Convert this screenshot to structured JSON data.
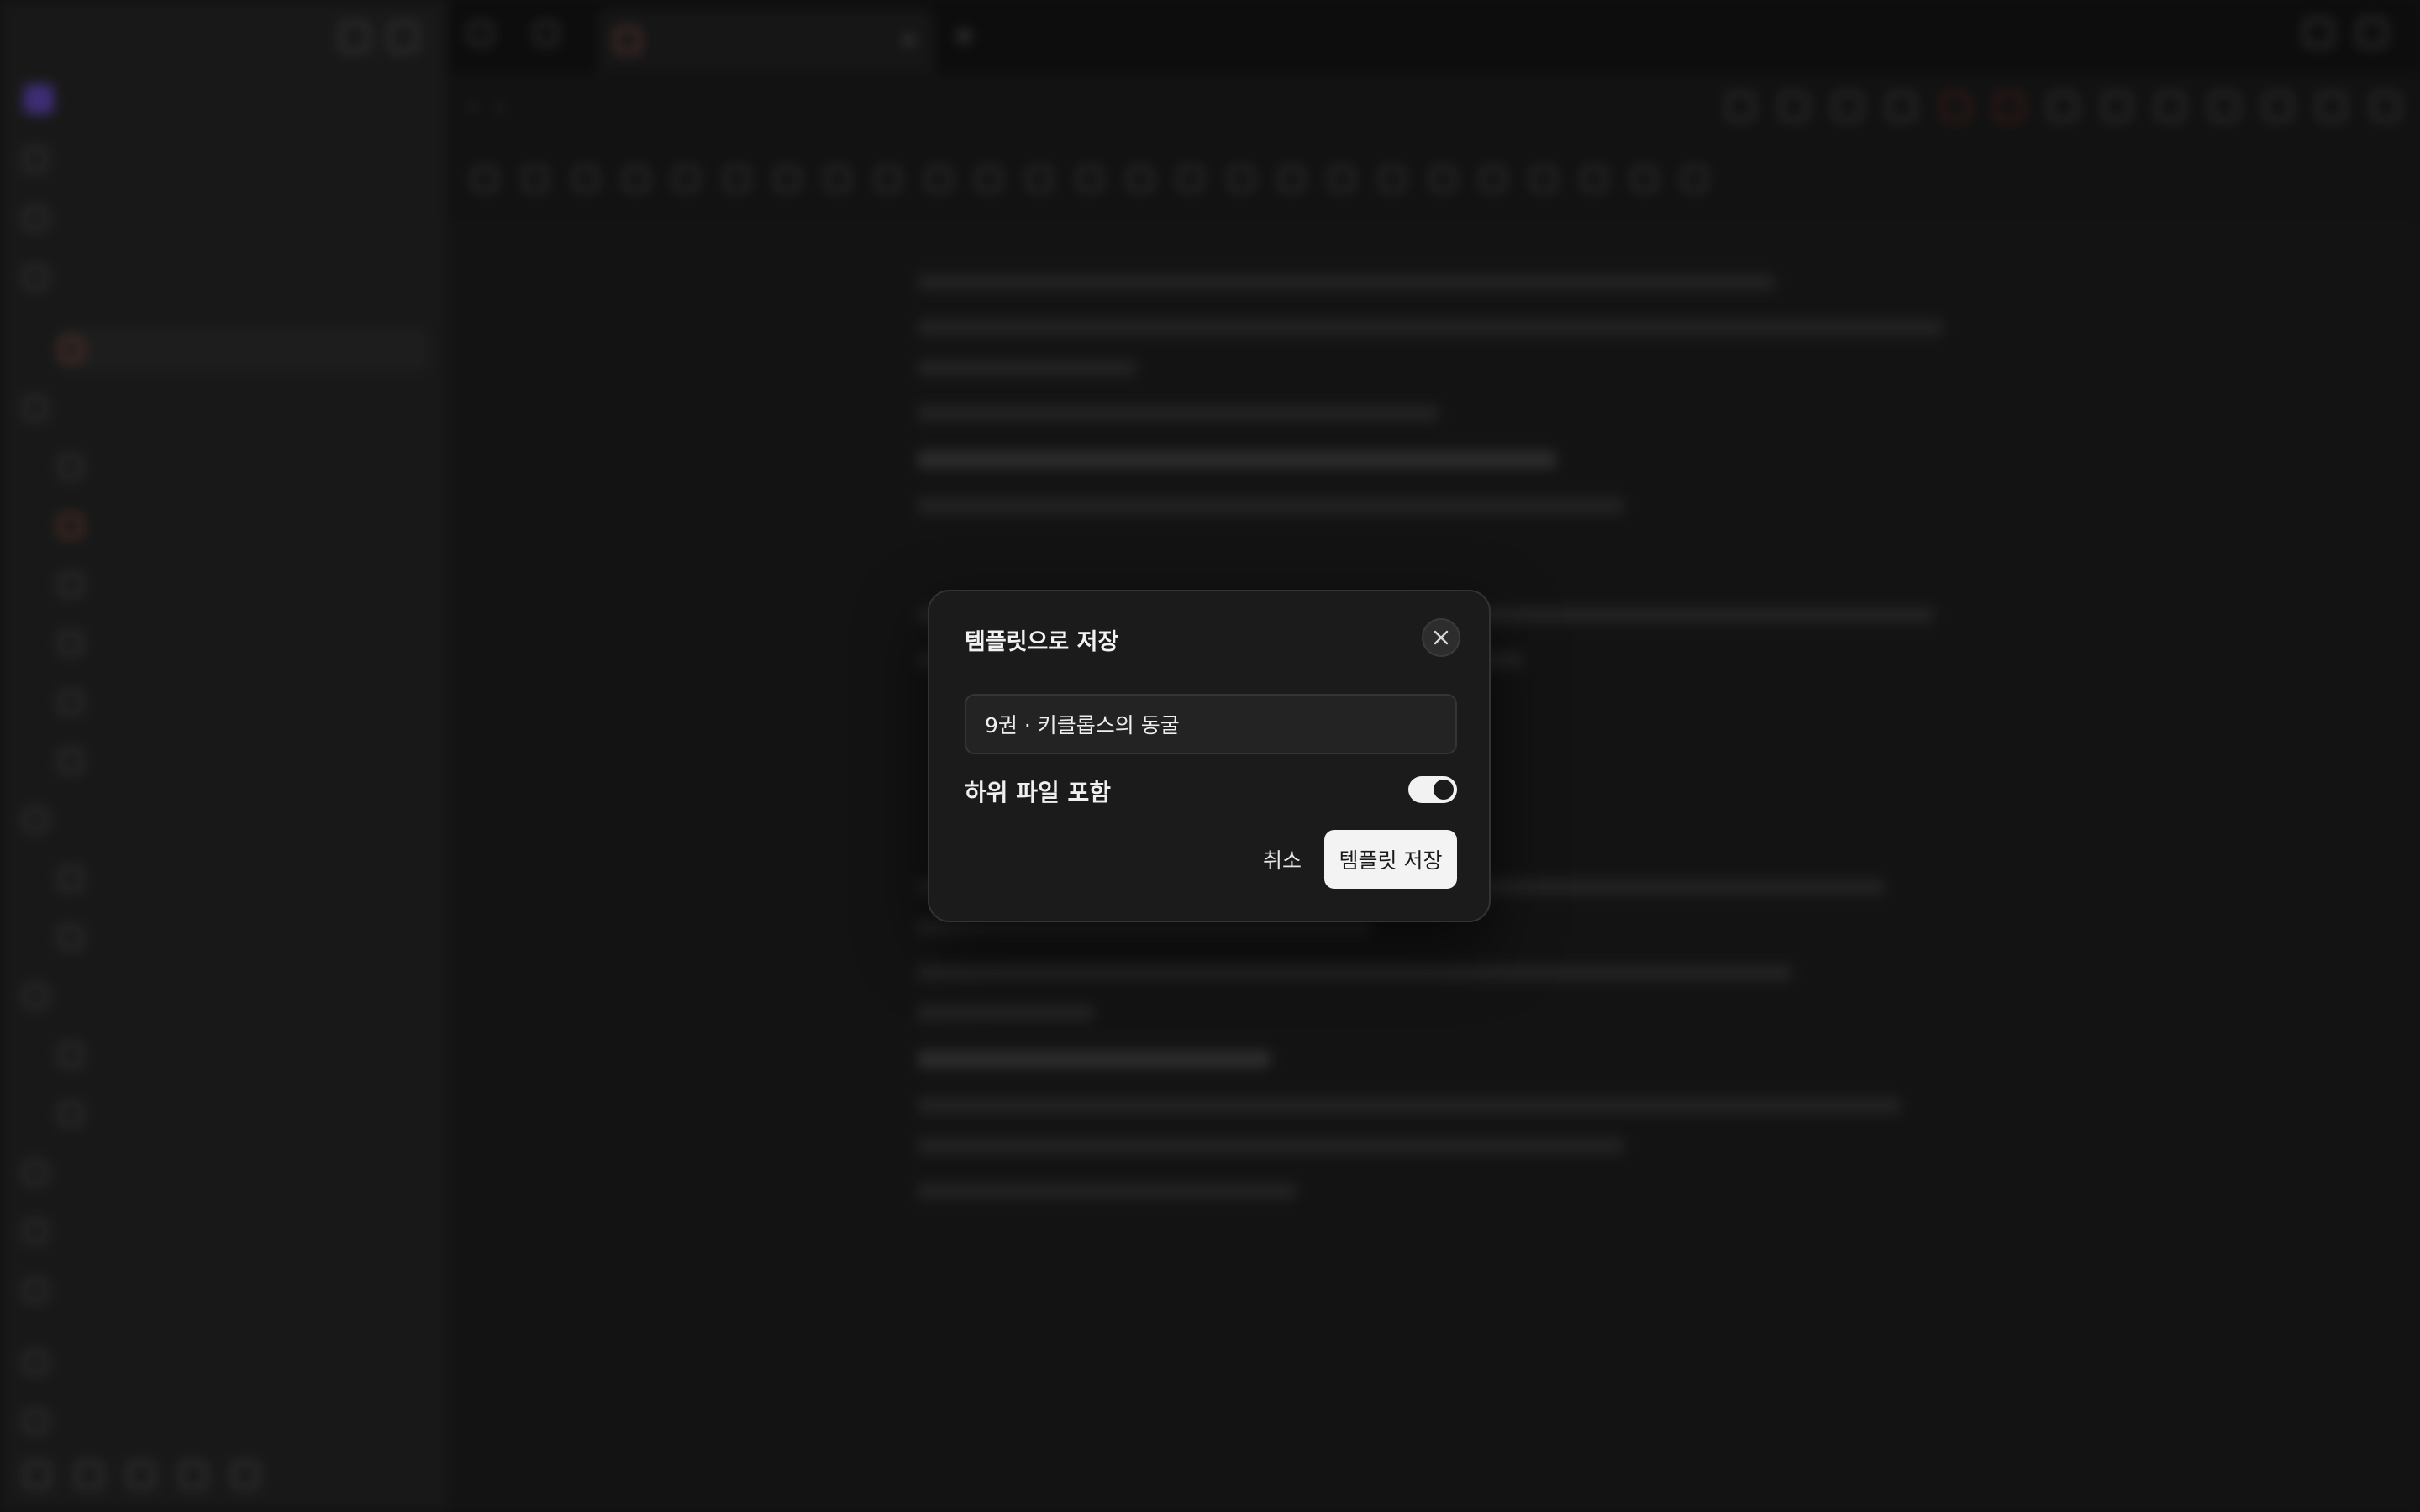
{
  "dialog": {
    "title": "템플릿으로 저장",
    "name_value": "9권 · 키클롭스의 동굴",
    "include_children_label": "하위 파일 포함",
    "include_children_on": true,
    "cancel_label": "취소",
    "save_label": "템플릿 저장"
  },
  "colors": {
    "modal_bg": "#1b1b1b",
    "primary_button": "#f3f3f3",
    "toggle_on": "#f2f2f2",
    "backdrop": "#1e1e1e"
  }
}
